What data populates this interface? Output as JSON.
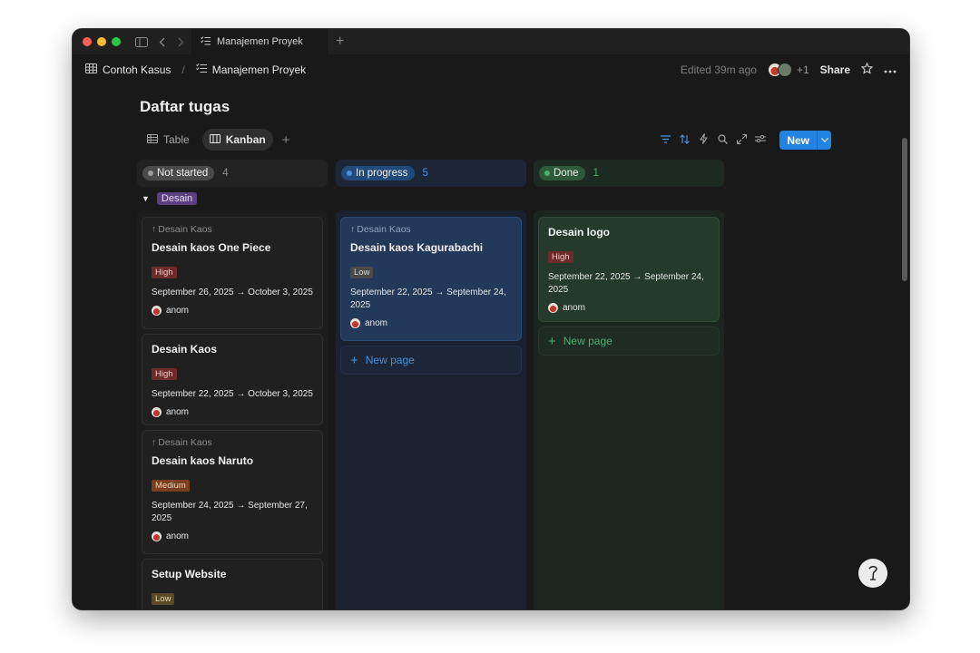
{
  "titlebar": {
    "tab_label": "Manajemen Proyek",
    "new_tab": "+"
  },
  "breadcrumb": {
    "workspace": "Contoh Kasus",
    "separator": "/",
    "page": "Manajemen Proyek"
  },
  "header": {
    "edited": "Edited 39m ago",
    "more_users": "+1",
    "share": "Share"
  },
  "page_title": "Daftar tugas",
  "views": [
    {
      "label": "Table",
      "active": false
    },
    {
      "label": "Kanban",
      "active": true
    }
  ],
  "add_view": "+",
  "toolbar": {
    "new_label": "New"
  },
  "group": {
    "label": "Desain"
  },
  "columns": [
    {
      "label": "Not started",
      "count": "4"
    },
    {
      "label": "In progress",
      "count": "5"
    },
    {
      "label": "Done",
      "count": "1"
    }
  ],
  "cards": {
    "not_started": [
      {
        "parent": "Desain Kaos",
        "title": "Desain kaos One Piece",
        "priority": "High",
        "date": "September 26, 2025 → October 3, 2025",
        "assignee": "anom"
      },
      {
        "parent": "",
        "title": "Desain Kaos",
        "priority": "High",
        "date": "September 22, 2025 → October 3, 2025",
        "assignee": "anom"
      },
      {
        "parent": "Desain Kaos",
        "title": "Desain kaos Naruto",
        "priority": "Medium",
        "date": "September 24, 2025 → September 27, 2025",
        "assignee": "anom"
      },
      {
        "parent": "",
        "title": "Setup Website",
        "priority": "Low",
        "date": "",
        "assignee": ""
      }
    ],
    "in_progress": [
      {
        "parent": "Desain Kaos",
        "title": "Desain kaos Kagurabachi",
        "priority": "Low",
        "date": "September 22, 2025 → September 24, 2025",
        "assignee": "anom"
      }
    ],
    "done": [
      {
        "parent": "",
        "title": "Desain logo",
        "priority": "High",
        "date": "September 22, 2025 → September 24, 2025",
        "assignee": "anom"
      }
    ]
  },
  "new_page": "New page",
  "colors": {
    "accent": "#2383e2",
    "high": "#6e2b2b",
    "medium": "#7a3f1e",
    "low_grey": "#4a4a4a",
    "low_brown": "#5a4a28"
  },
  "icons": {
    "window_sidebar": "sidebar-toggle-icon",
    "back": "chevron-left-icon",
    "forward": "chevron-right-icon",
    "filter": "filter-icon",
    "sort": "sort-icon",
    "automation": "lightning-icon",
    "search": "search-icon",
    "expand": "expand-icon",
    "settings": "sliders-icon",
    "star": "star-icon",
    "more": "more-icon",
    "help": "help-icon"
  }
}
